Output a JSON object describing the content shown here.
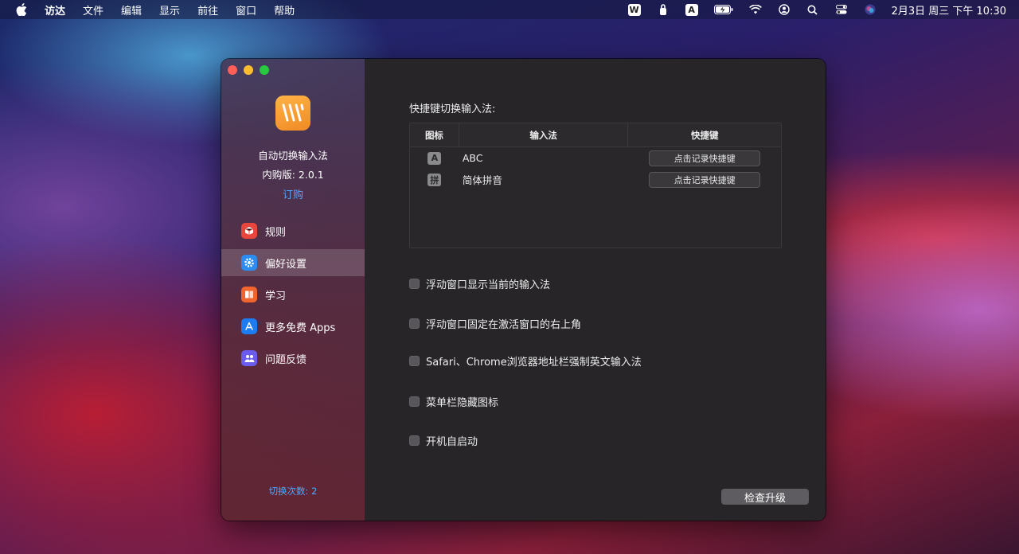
{
  "menubar": {
    "items": [
      "访达",
      "文件",
      "编辑",
      "显示",
      "前往",
      "窗口",
      "帮助"
    ],
    "status_icons": [
      "w-app-icon",
      "keychain-icon",
      "input-source-icon",
      "battery-icon",
      "wifi-icon",
      "user-icon",
      "spotlight-icon",
      "control-center-icon",
      "siri-icon"
    ],
    "input_source_label": "A",
    "w_label": "W",
    "clock": "2月3日 周三 下午 10:30"
  },
  "app": {
    "name": "自动切换输入法",
    "version": "内购版: 2.0.1",
    "purchase": "订购"
  },
  "nav": {
    "items": [
      {
        "label": "规则",
        "icon": "rules-icon",
        "color": "#e8453c"
      },
      {
        "label": "偏好设置",
        "icon": "gear-icon",
        "color": "#2d8cf0"
      },
      {
        "label": "学习",
        "icon": "book-icon",
        "color": "#f0642d"
      },
      {
        "label": "更多免费 Apps",
        "icon": "app-store-icon",
        "color": "#1e7cf2"
      },
      {
        "label": "问题反馈",
        "icon": "feedback-icon",
        "color": "#6a5cf0"
      }
    ],
    "active_index": 1
  },
  "footer": {
    "switch_count": "切换次数: 2"
  },
  "main": {
    "section_title": "快捷键切换输入法:",
    "table": {
      "headers": [
        "图标",
        "输入法",
        "快捷键"
      ],
      "rows": [
        {
          "icon_label": "A",
          "name": "ABC",
          "shortcut": "点击记录快捷键"
        },
        {
          "icon_label": "拼",
          "name": "简体拼音",
          "shortcut": "点击记录快捷键"
        }
      ]
    },
    "options": [
      {
        "label": "浮动窗口显示当前的输入法",
        "checked": false
      },
      {
        "label": "浮动窗口固定在激活窗口的右上角",
        "checked": false
      },
      {
        "label": "Safari、Chrome浏览器地址栏强制英文输入法",
        "checked": false
      },
      {
        "label": "菜单栏隐藏图标",
        "checked": false
      },
      {
        "label": "开机自启动",
        "checked": false
      }
    ],
    "upgrade_button": "检查升级"
  }
}
